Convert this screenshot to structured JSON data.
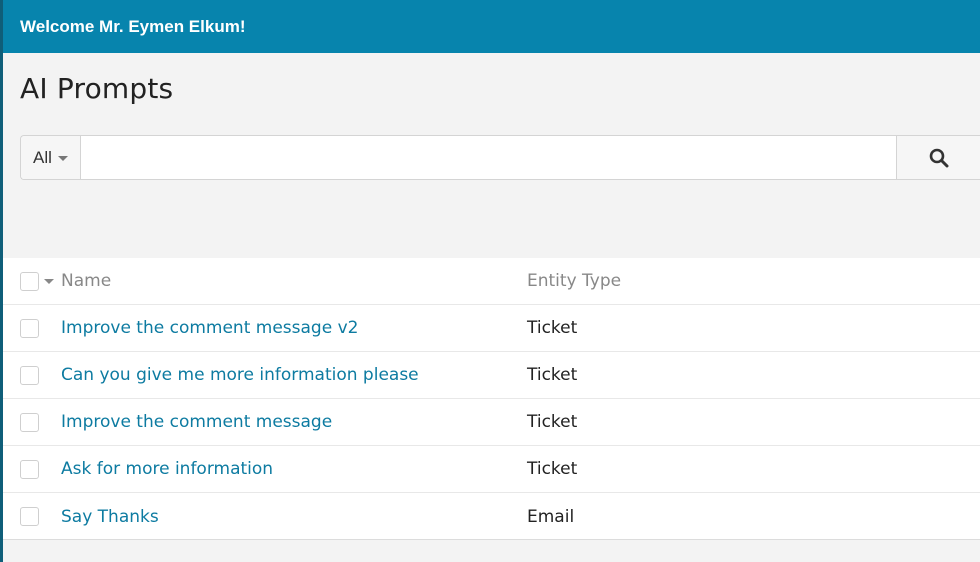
{
  "header": {
    "welcome": "Welcome Mr. Eymen Elkum!"
  },
  "page": {
    "title": "AI Prompts"
  },
  "search": {
    "filter_label": "All",
    "query": "",
    "placeholder": ""
  },
  "table": {
    "columns": {
      "name": "Name",
      "entity_type": "Entity Type"
    },
    "rows": [
      {
        "name": "Improve the comment message v2",
        "entity_type": "Ticket"
      },
      {
        "name": "Can you give me more information please",
        "entity_type": "Ticket"
      },
      {
        "name": "Improve the comment message",
        "entity_type": "Ticket"
      },
      {
        "name": "Ask for more information",
        "entity_type": "Ticket"
      },
      {
        "name": "Say Thanks",
        "entity_type": "Email"
      }
    ]
  },
  "colors": {
    "topbar": "#0784ad",
    "link": "#0d7ba1",
    "background": "#f3f3f3"
  },
  "icons": [
    "search-icon",
    "caret-down-icon"
  ]
}
